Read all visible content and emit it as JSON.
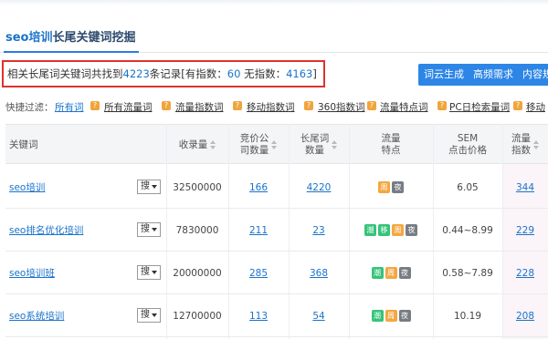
{
  "page": {
    "title_seo": "seo培训",
    "title_rest": "长尾关键词挖掘"
  },
  "summary": {
    "prefix": "相关长尾词关键词共找到",
    "total": "4223",
    "mid": "条记录[有指数：",
    "with_index": "60",
    "mid2": " 无指数：",
    "without_index": "4163",
    "suffix": "]"
  },
  "actions": {
    "word_cloud": "词云生成",
    "high_demand": "高频需求",
    "content": "内容规"
  },
  "filters": {
    "label": "快捷过滤：",
    "items": [
      "所有词",
      "所有流量词",
      "流量指数词",
      "移动指数词",
      "360指数词",
      "流量特点词",
      "PC日检索量词",
      "移动"
    ]
  },
  "table": {
    "headers": {
      "keyword": "关键词",
      "index": "收录量",
      "bidding_line1": "竞价公",
      "bidding_line2": "司数量",
      "longtail_line1": "长尾词",
      "longtail_line2": "数量",
      "traffic_line1": "流量",
      "traffic_line2": "特点",
      "sem_line1": "SEM",
      "sem_line2": "点击价格",
      "flow_line1": "流量",
      "flow_line2": "指数"
    },
    "rows": [
      {
        "keyword": "seo培训",
        "search": "搜",
        "index": "32500000",
        "bidding": "166",
        "longtail": "4220",
        "tags": [
          {
            "t": "周",
            "c": "orange"
          },
          {
            "t": "夜",
            "c": "gray"
          }
        ],
        "sem": "6.05",
        "flow": "344"
      },
      {
        "keyword": "seo排名优化培训",
        "search": "搜",
        "index": "7830000",
        "bidding": "211",
        "longtail": "23",
        "tags": [
          {
            "t": "潮",
            "c": "green"
          },
          {
            "t": "移",
            "c": "green"
          },
          {
            "t": "周",
            "c": "orange"
          },
          {
            "t": "夜",
            "c": "gray"
          }
        ],
        "sem": "0.44~8.99",
        "flow": "229"
      },
      {
        "keyword": "seo培训班",
        "search": "搜",
        "index": "20000000",
        "bidding": "285",
        "longtail": "368",
        "tags": [
          {
            "t": "潮",
            "c": "green"
          },
          {
            "t": "周",
            "c": "orange"
          },
          {
            "t": "夜",
            "c": "gray"
          }
        ],
        "sem": "0.58~7.89",
        "flow": "228"
      },
      {
        "keyword": "seo系统培训",
        "search": "搜",
        "index": "12700000",
        "bidding": "113",
        "longtail": "54",
        "tags": [
          {
            "t": "潮",
            "c": "green"
          },
          {
            "t": "周",
            "c": "orange"
          },
          {
            "t": "夜",
            "c": "gray"
          }
        ],
        "sem": "10.19",
        "flow": "208"
      }
    ]
  },
  "colors": {
    "accent": "#2d86e6",
    "highlight_border": "#e0312f",
    "link": "#1a73c9"
  }
}
